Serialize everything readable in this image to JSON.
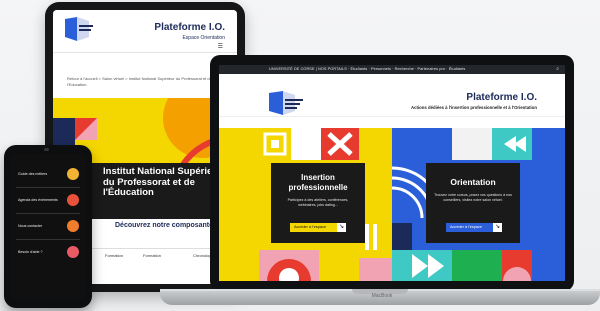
{
  "tablet": {
    "title": "Plateforme I.O.",
    "subtitle": "Espace Orientation",
    "menu_icon": "hamburger-icon",
    "breadcrumb": "Retour à l'accueil  >  Salon virtuel  >  Institut National Supérieur du Professorat et de l'Education",
    "hero_heading": "Institut National Supérieur du Professorat et de l'Éducation",
    "discover": "Découvrez notre composante",
    "tabs": [
      "Formation",
      "Formation",
      "Chronologie"
    ]
  },
  "laptop": {
    "nav_text": "UNIVERSITÉ DE CORSE  |  NOS PORTAILS  ·  Étudiants  ·  Personnels  ·  Recherche  ·  Partenaires pro  ·  Étudiants",
    "title": "Plateforme I.O.",
    "subtitle": "Actions dédiées à l'insertion professionnelle et à l'Orientation",
    "brand": "MacBook",
    "insertion": {
      "title": "Insertion professionnelle",
      "text": "Participez à des ateliers, conférences, webinaires, jobs dating...",
      "button": "Accéder à l'espace"
    },
    "orientation": {
      "title": "Orientation",
      "text": "Trouvez votre cursus, posez vos questions à nos conseillers, visitez notre salon virtuel.",
      "button": "Accéder à l'espace"
    }
  },
  "phone": {
    "items": [
      {
        "label": "Guide des métiers",
        "color": "#f2b233"
      },
      {
        "label": "Agenda des événements",
        "color": "#e8523a"
      },
      {
        "label": "Nous contacter",
        "color": "#f07d2c"
      },
      {
        "label": "Besoin d'aide ?",
        "color": "#e85a64"
      }
    ]
  },
  "colors": {
    "navy": "#1c2a5a",
    "yellow": "#f4d600",
    "red": "#e63b2e",
    "blue": "#2b5fd9",
    "teal": "#3ec9c4",
    "green": "#1eb050",
    "pink": "#f2a3b3"
  }
}
